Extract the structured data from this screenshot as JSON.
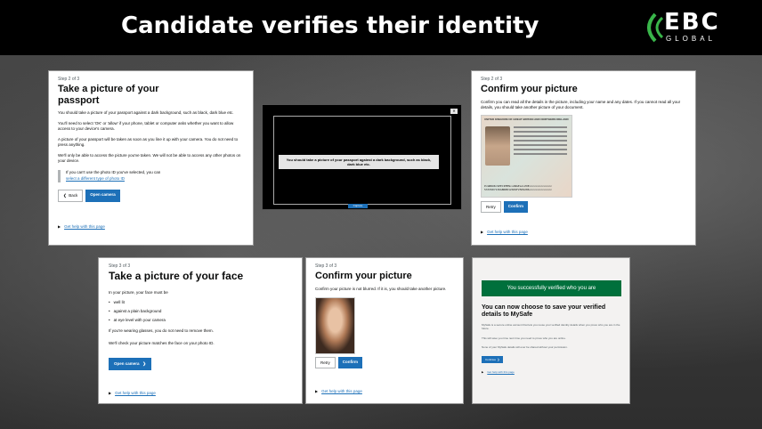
{
  "slide": {
    "title": "Candidate verifies their identity",
    "logo_brand": "EBC",
    "logo_sub": "GLOBAL"
  },
  "panel_passport": {
    "step": "Step 2 of 3",
    "heading_line1": "Take a picture of your",
    "heading_line2": "passport",
    "para1": "You should take a picture of your passport against a dark background, such as black, dark blue etc.",
    "para2": "You'll need to select 'OK' or 'allow' if your phone, tablet or computer asks whether you want to allow access to your device's camera.",
    "para3": "A picture of your passport will be taken as soon as you line it up with your camera. You do not need to press anything.",
    "para4": "We'll only be able to access the picture you've taken. We will not be able to access any other photos on your device.",
    "inset_text": "If you can't use the photo ID you've selected, you can",
    "inset_link": "select a different type of photo ID",
    "back_label": "Back",
    "open_camera_label": "Open camera",
    "help_link": "Get help with this page"
  },
  "panel_camera": {
    "message": "You should take a picture of your passport against a dark background, such as black, dark blue etc.",
    "close_label": "✕",
    "capture_label": "Capture"
  },
  "panel_confirm_passport": {
    "step": "Step 2 of 3",
    "heading": "Confirm your picture",
    "para": "Confirm you can read all the details in the picture, including your name and any dates. If you cannot read all your details, you should take another picture of your document.",
    "passport_header": "UNITED KINGDOM OF GREAT BRITAIN AND NORTHERN IRELAND",
    "mrz_line1": "P<GBRUK<SPECIMEN<<ANGELA<ZOE<<<<<<<<<<<<<<",
    "mrz_line2": "5333907136GBR8812049F2509286<<<<<<<<<<<<<<",
    "retry_label": "Retry",
    "confirm_label": "Confirm",
    "help_link": "Get help with this page"
  },
  "panel_face": {
    "step": "Step 3 of 3",
    "heading": "Take a picture of your face",
    "intro": "In your picture, your face must be",
    "bullets": [
      "well lit",
      "against a plain background",
      "at eye level with your camera"
    ],
    "para_glasses": "If you're wearing glasses, you do not need to remove them.",
    "para_check": "We'll check your picture matches the face on your photo ID.",
    "open_camera_label": "Open camera",
    "help_link": "Get help with this page"
  },
  "panel_confirm_face": {
    "step": "Step 3 of 3",
    "heading": "Confirm your picture",
    "para": "Confirm your picture is not blurred. If it is, you should take another picture.",
    "retry_label": "Retry",
    "confirm_label": "Confirm",
    "help_link": "Get help with this page"
  },
  "panel_success": {
    "banner": "You successfully verified who you are",
    "heading": "You can now choose to save your verified details to MySafe",
    "para1": "MySafe is a secure online account that lets you reuse your verified identity details when you prove who you are in the future.",
    "para2": "This will save you time next time you need to prove who you are online.",
    "para3": "None of your MySafe details will ever be shared without your permission.",
    "continue_label": "Continue",
    "help_link": "Get help with this page"
  }
}
